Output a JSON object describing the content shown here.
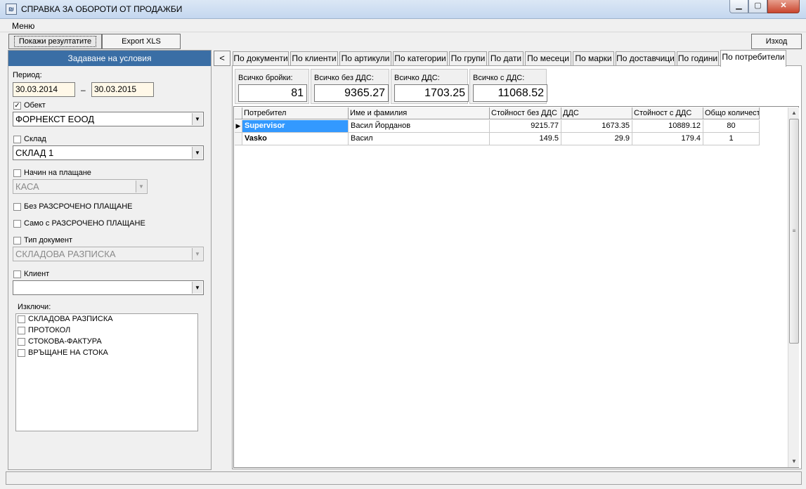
{
  "window": {
    "title": "СПРАВКА ЗА ОБОРОТИ ОТ ПРОДАЖБИ",
    "icon": "app-report-icon",
    "minimize": "minimize-icon",
    "maximize": "maximize-icon",
    "close": "close-icon"
  },
  "menu": {
    "label": "Меню"
  },
  "toolbar": {
    "show_results": "Покажи резултатите",
    "export_xls": "Export XLS",
    "exit": "Изход"
  },
  "conditions": {
    "header": "Задаване на условия",
    "period_label": "Период:",
    "date_from": "30.03.2014",
    "date_separator": "–",
    "date_to": "30.03.2015",
    "object_label": "Обект",
    "object_checked": true,
    "object_value": "ФОРНЕКСТ ЕООД",
    "warehouse_label": "Склад",
    "warehouse_checked": false,
    "warehouse_value": "СКЛАД 1",
    "payment_label": "Начин на плащане",
    "payment_checked": false,
    "payment_value": "КАСА",
    "no_installment_label": "Без РАЗСРОЧЕНО ПЛАЩАНЕ",
    "only_installment_label": "Само с РАЗСРОЧЕНО ПЛАЩАНЕ",
    "doctype_label": "Тип документ",
    "doctype_checked": false,
    "doctype_value": "СКЛАДОВА РАЗПИСКА",
    "client_label": "Клиент",
    "client_checked": false,
    "client_value": "",
    "exclude_label": "Изключи:",
    "exclude_items": [
      "СКЛАДОВА РАЗПИСКА",
      "ПРОТОКОЛ",
      "СТОКОВА-ФАКТУРА",
      "ВРЪЩАНЕ НА СТОКА"
    ]
  },
  "collapse_button": "<",
  "tabs": [
    "По документи",
    "По клиенти",
    "По артикули",
    "По категории",
    "По групи",
    "По дати",
    "По месеци",
    "По марки",
    "По доставчици",
    "По години",
    "По потребители"
  ],
  "active_tab": 10,
  "summary": {
    "total_qty_label": "Всичко бройки:",
    "total_qty": "81",
    "total_no_vat_label": "Всичко без ДДС:",
    "total_no_vat": "9365.27",
    "total_vat_label": "Всичко ДДС:",
    "total_vat": "1703.25",
    "total_with_vat_label": "Всичко с ДДС:",
    "total_with_vat": "11068.52"
  },
  "grid": {
    "columns": [
      "Потребител",
      "Име и фамилия",
      "Стойност без ДДС",
      "ДДС",
      "Стойност с ДДС",
      "Общо количест"
    ],
    "rows": [
      {
        "user": "Supervisor",
        "name": "Васил Йорданов",
        "no_vat": "9215.77",
        "vat": "1673.35",
        "with_vat": "10889.12",
        "qty": "80"
      },
      {
        "user": "Vasko",
        "name": "Васил",
        "no_vat": "149.5",
        "vat": "29.9",
        "with_vat": "179.4",
        "qty": "1"
      }
    ]
  }
}
